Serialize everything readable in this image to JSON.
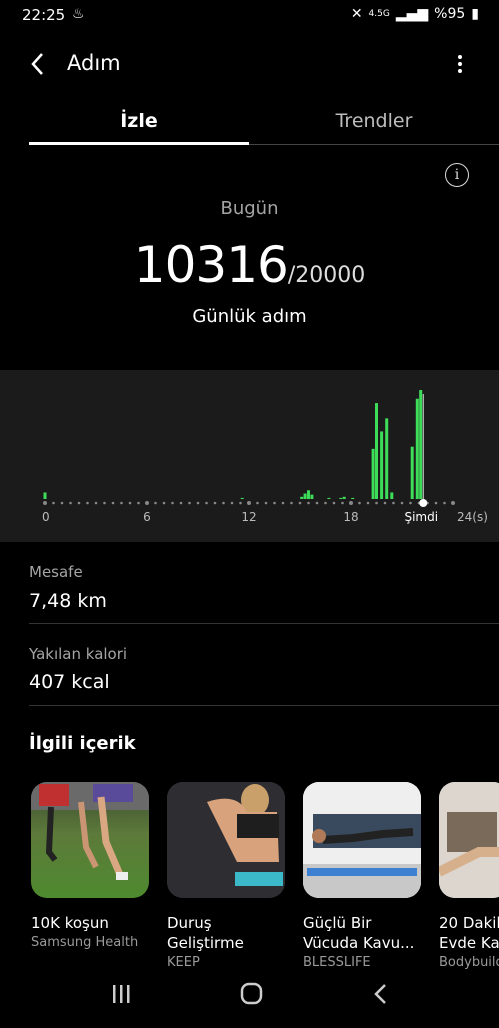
{
  "status_bar": {
    "time": "22:25",
    "network": "4.5G",
    "battery": "%95"
  },
  "header": {
    "title": "Adım"
  },
  "tabs": [
    {
      "label": "İzle"
    },
    {
      "label": "Trendler"
    }
  ],
  "today": {
    "label": "Bugün",
    "steps": "10316",
    "goal": "/20000",
    "caption": "Günlük adım"
  },
  "chart_data": {
    "type": "bar",
    "xlabel": "",
    "ylabel": "",
    "x_ticks": [
      "0",
      "6",
      "12",
      "18",
      "Şimdi",
      "24(s)"
    ],
    "xlim": [
      0,
      24
    ],
    "bars": [
      {
        "x": 0.0,
        "value": 6
      },
      {
        "x": 11.6,
        "value": 1
      },
      {
        "x": 15.1,
        "value": 2
      },
      {
        "x": 15.3,
        "value": 5
      },
      {
        "x": 15.5,
        "value": 8
      },
      {
        "x": 15.7,
        "value": 4
      },
      {
        "x": 16.7,
        "value": 1
      },
      {
        "x": 17.4,
        "value": 1
      },
      {
        "x": 17.6,
        "value": 2
      },
      {
        "x": 18.1,
        "value": 1
      },
      {
        "x": 19.3,
        "value": 46
      },
      {
        "x": 19.5,
        "value": 88
      },
      {
        "x": 19.8,
        "value": 62
      },
      {
        "x": 20.1,
        "value": 74
      },
      {
        "x": 20.4,
        "value": 6
      },
      {
        "x": 21.6,
        "value": 48
      },
      {
        "x": 21.9,
        "value": 92
      },
      {
        "x": 22.1,
        "value": 100
      }
    ],
    "ylim": [
      0,
      100
    ]
  },
  "stats": [
    {
      "label": "Mesafe",
      "value": "7,48 km"
    },
    {
      "label": "Yakılan kalori",
      "value": "407 kcal"
    }
  ],
  "related": {
    "title": "İlgili içerik",
    "cards": [
      {
        "title": "10K koşun",
        "subtitle": "Samsung Health"
      },
      {
        "title": "Duruş Geliştirme",
        "subtitle": "KEEP"
      },
      {
        "title": "Güçlü Bir Vücuda Kavu...",
        "subtitle": "BLESSLIFE"
      },
      {
        "title": "20 Dakik Evde Ka",
        "subtitle": "Bodybuild"
      }
    ]
  },
  "colors": {
    "accent": "#3ddc59",
    "background": "#000000",
    "chart_bg": "#1b1b1b"
  }
}
